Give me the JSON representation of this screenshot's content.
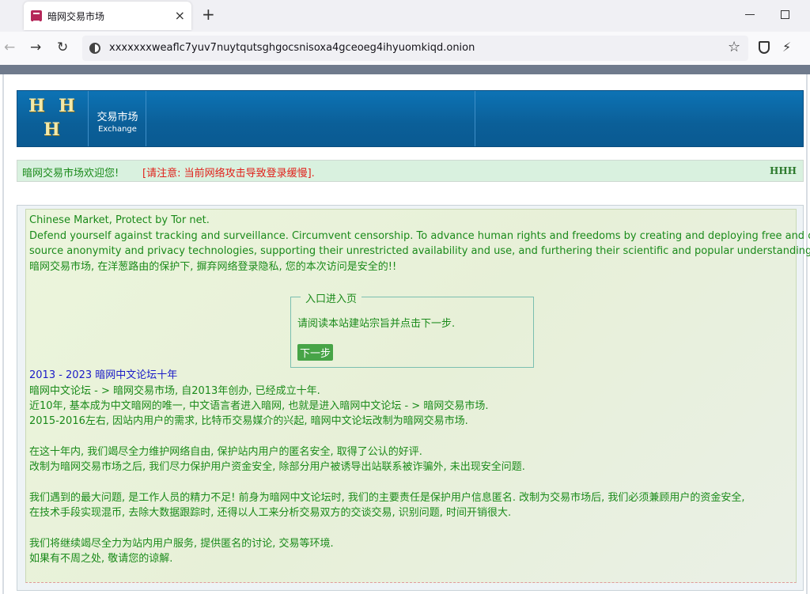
{
  "browser": {
    "tab_title": "暗网交易市场",
    "tab_close": "×",
    "new_tab": "+",
    "url": "xxxxxxxweaflc7yuv7nuytqutsghgocsnisoxa4gceoeg4ihyuomkiqd.onion",
    "nav_back": "←",
    "nav_forward": "→",
    "nav_reload": "↻",
    "star": "☆",
    "magic": "⚡"
  },
  "banner": {
    "logo_glyph": "H",
    "brand_cn": "交易市场",
    "brand_en": "Exchange"
  },
  "notice": {
    "welcome": "暗网交易市场欢迎您!",
    "warning": "[请注意: 当前网络攻击导致登录缓慢].",
    "mini_logo": "HHH"
  },
  "intro": {
    "line1": "Chinese Market, Protect by Tor net.",
    "line2": "Defend yourself against tracking and surveillance. Circumvent censorship. To advance human rights and freedoms by creating and deploying free and open",
    "line3": "source anonymity and privacy technologies, supporting their unrestricted availability and use, and furthering their scientific and popular understanding.",
    "line4": "暗网交易市场, 在洋葱路由的保护下, 摒弃网络登录隐私, 您的本次访问是安全的!!"
  },
  "entry": {
    "legend": "入口进入页",
    "instruction": "请阅读本站建站宗旨并点击下一步.",
    "next_button": "下一步"
  },
  "history": {
    "title": "2013 - 2023 暗网中文论坛十年",
    "p1": [
      "暗网中文论坛 - > 暗网交易市场, 自2013年创办, 已经成立十年.",
      "近10年, 基本成为中文暗网的唯一, 中文语言者进入暗网, 也就是进入暗网中文论坛 - > 暗网交易市场.",
      "2015-2016左右, 因站内用户的需求, 比特币交易媒介的兴起, 暗网中文论坛改制为暗网交易市场."
    ],
    "p2": [
      "在这十年内, 我们竭尽全力维护网络自由, 保护站内用户的匿名安全, 取得了公认的好评.",
      "改制为暗网交易市场之后, 我们尽力保护用户资金安全, 除部分用户被诱导出站联系被诈骗外, 未出现安全问题."
    ],
    "p3": [
      "我们遇到的最大问题, 是工作人员的精力不足! 前身为暗网中文论坛时, 我们的主要责任是保护用户信息匿名. 改制为交易市场后, 我们必须兼顾用户的资金安全,",
      "在技术手段实现混币, 去除大数据跟踪时, 还得以人工来分析交易双方的交谈交易, 识别问题, 时间开销很大."
    ],
    "p4": [
      "我们将继续竭尽全力为站内用户服务, 提供匿名的讨论, 交易等环境.",
      "如果有不周之处, 敬请您的谅解."
    ]
  }
}
